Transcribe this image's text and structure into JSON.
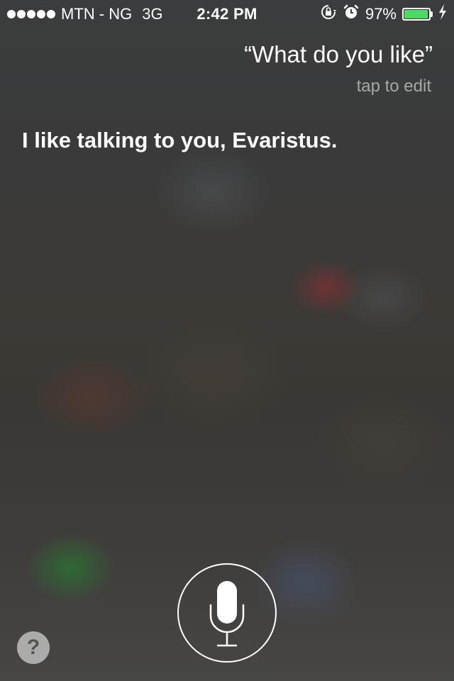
{
  "status_bar": {
    "carrier": "MTN - NG",
    "network": "3G",
    "time": "2:42 PM",
    "battery_percent_label": "97%",
    "battery_level": 0.97,
    "signal_dots": 5,
    "icons": [
      "rotation-lock-icon",
      "alarm-icon",
      "battery-icon",
      "charging-bolt-icon"
    ],
    "colors": {
      "battery_fill": "#4cd964"
    }
  },
  "siri": {
    "query": "“What do you like”",
    "tap_to_edit": "tap to edit",
    "response": "I like talking to you, Evaristus."
  },
  "controls": {
    "mic_icon": "microphone-icon",
    "help_label": "?"
  }
}
